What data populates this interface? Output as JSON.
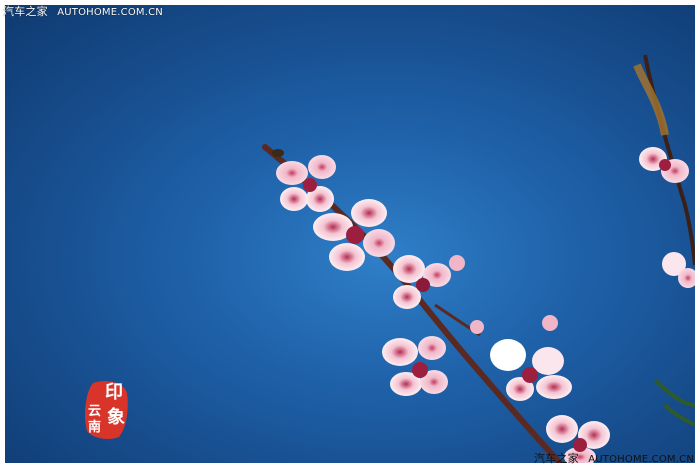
{
  "watermarks": {
    "top_left_cn": "汽车之家",
    "top_left_url": "AUTOHOME.COM.CN",
    "bottom_right_cn": "汽车之家",
    "bottom_right_url": "AUTOHOME.COM.CN"
  },
  "seal": {
    "text": [
      "印",
      "象",
      "云",
      "南"
    ],
    "color": "#d8342a"
  },
  "colors": {
    "sky_center": "#2f7fc8",
    "sky_edge": "#0f3a70",
    "blossom": "#f4c9d6",
    "blossom_center": "#9c1f3f",
    "branch": "#5a2a22"
  }
}
